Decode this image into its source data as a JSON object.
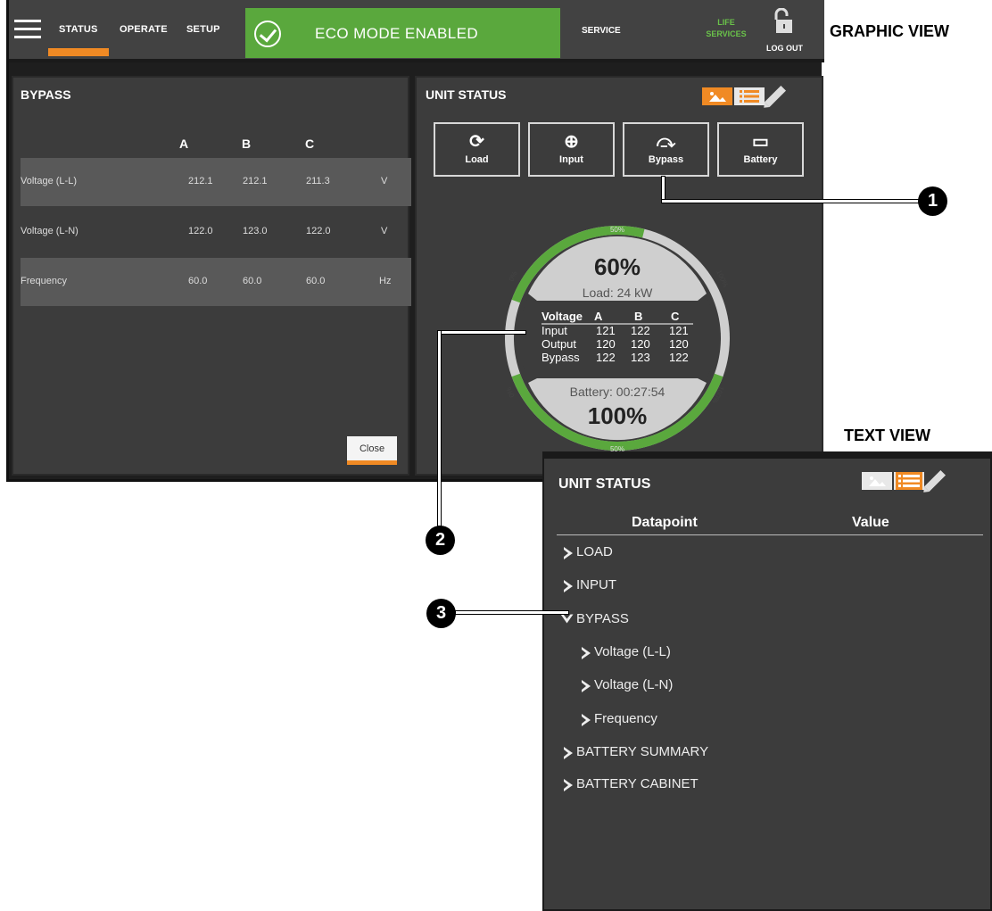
{
  "headings": {
    "graphic_view": "GRAPHIC VIEW",
    "text_view": "TEXT VIEW"
  },
  "nav": {
    "tabs": [
      {
        "label": "STATUS",
        "active": true
      },
      {
        "label": "OPERATE"
      },
      {
        "label": "SETUP"
      }
    ],
    "eco_banner": "ECO MODE ENABLED",
    "service": "SERVICE",
    "life_services_line1": "LIFE",
    "life_services_line2": "SERVICES",
    "logout": "LOG OUT"
  },
  "bypass_panel": {
    "title": "BYPASS",
    "columns": [
      "A",
      "B",
      "C"
    ],
    "rows": [
      {
        "label": "Voltage (L-L)",
        "a": "212.1",
        "b": "212.1",
        "c": "211.3",
        "unit": "V"
      },
      {
        "label": "Voltage (L-N)",
        "a": "122.0",
        "b": "123.0",
        "c": "122.0",
        "unit": "V"
      },
      {
        "label": "Frequency",
        "a": "60.0",
        "b": "60.0",
        "c": "60.0",
        "unit": "Hz"
      }
    ],
    "close_label": "Close"
  },
  "unit_status": {
    "title": "UNIT STATUS",
    "buttons": [
      {
        "label": "Load",
        "icon": "load-icon"
      },
      {
        "label": "Input",
        "icon": "input-icon"
      },
      {
        "label": "Bypass",
        "icon": "bypass-icon"
      },
      {
        "label": "Battery",
        "icon": "battery-icon"
      }
    ],
    "gauge": {
      "load_percent": "60%",
      "load_fraction": 0.6,
      "load_text": "Load: 24 kW",
      "battery_percent": "100%",
      "battery_fraction": 1.0,
      "battery_text": "Battery: 00:27:54",
      "scale_top_mid": "50%",
      "scale_bottom_mid": "50%",
      "scale_0_top": "0%",
      "scale_100_top": "100%",
      "scale_0_bottom": "0%",
      "scale_100_bottom": "100%",
      "table_header": [
        "Voltage",
        "A",
        "B",
        "C"
      ],
      "table_rows": [
        [
          "Input",
          "121",
          "122",
          "121"
        ],
        [
          "Output",
          "120",
          "120",
          "120"
        ],
        [
          "Bypass",
          "122",
          "123",
          "122"
        ]
      ],
      "accent": "#5aa83d"
    }
  },
  "text_view": {
    "title": "UNIT STATUS",
    "col_datapoint": "Datapoint",
    "col_value": "Value",
    "items": [
      {
        "label": "LOAD",
        "expanded": false
      },
      {
        "label": "INPUT",
        "expanded": false
      },
      {
        "label": "BYPASS",
        "expanded": true
      },
      {
        "label": "Voltage (L-L)",
        "child": true
      },
      {
        "label": "Voltage (L-N)",
        "child": true
      },
      {
        "label": "Frequency",
        "child": true
      },
      {
        "label": "BATTERY SUMMARY",
        "expanded": false
      },
      {
        "label": "BATTERY CABINET",
        "expanded": false
      }
    ]
  },
  "callouts": [
    "1",
    "2",
    "3"
  ],
  "colors": {
    "accent_orange": "#f08a24",
    "eco_green": "#5aa83d",
    "panel": "#3c3c3c"
  }
}
